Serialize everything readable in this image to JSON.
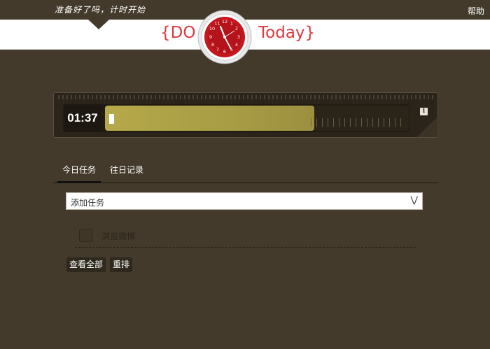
{
  "header": {
    "tagline": "准备好了吗，计时开始",
    "help_label": "帮助",
    "brand_left": "{DO",
    "brand_right": "Today}"
  },
  "timer": {
    "time": "01:37",
    "progress_fraction": 0.69
  },
  "tabs": [
    {
      "label": "今日任务",
      "active": true
    },
    {
      "label": "往日记录",
      "active": false
    }
  ],
  "add_task": {
    "label": "添加任务"
  },
  "tasks": [
    {
      "text": "浏览微博",
      "checked": false
    }
  ],
  "actions": {
    "view_all": "查看全部",
    "reorder": "重排"
  },
  "colors": {
    "background": "#433a2b",
    "brand_red": "#e0393e",
    "progress_fill": "#b5a94a"
  }
}
